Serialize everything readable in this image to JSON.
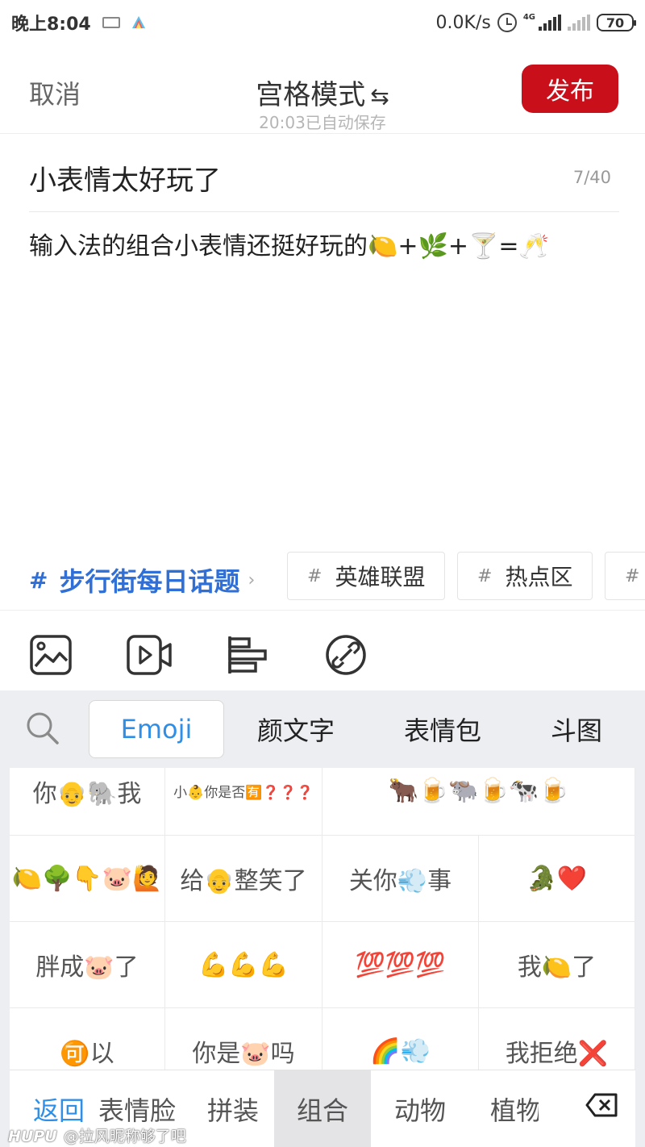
{
  "status_bar": {
    "time": "晚上8:04",
    "net_speed": "0.0K/s",
    "network_type": "4G",
    "battery": "70",
    "icons": [
      "keyboard-icon",
      "app-icon",
      "alarm-icon",
      "signal-icon",
      "signal-icon",
      "battery-icon"
    ]
  },
  "nav": {
    "cancel": "取消",
    "mode": "宫格模式",
    "mode_icon": "⇆",
    "autosave": "20:03已自动保存",
    "publish": "发布",
    "publish_color": "#c9101a"
  },
  "editor": {
    "title": "小表情太好玩了",
    "title_count": "7/40",
    "body": "输入法的组合小表情还挺好玩的🍋+🌿+🍸=🥂"
  },
  "topics": {
    "main": "步行街每日话题",
    "chips": [
      "英雄联盟",
      "热点区",
      ""
    ]
  },
  "toolbar": {
    "icons": [
      "image-icon",
      "video-icon",
      "align-icon",
      "link-icon"
    ]
  },
  "keyboard": {
    "tabs": [
      "Emoji",
      "颜文字",
      "表情包",
      "斗图"
    ],
    "active_tab": "Emoji",
    "accent_color": "#2f8fe6",
    "combos": [
      [
        "你👴🐘我",
        "小👶你是否🈶❓❓❓",
        "🐂🍺🐃🍺🐄🍺"
      ],
      [
        "🍋🌳👇🐷🙋",
        "给👴整笑了",
        "关你💨事",
        "🐊❤️"
      ],
      [
        "胖成🐷了",
        "💪💪💪",
        "💯💯💯",
        "我🍋了"
      ],
      [
        "🉑以",
        "你是🐷吗",
        "🌈💨",
        "我拒绝❌"
      ]
    ],
    "categories": [
      "返回",
      "表情脸",
      "拼装",
      "组合",
      "动物",
      "植物"
    ],
    "active_category": "组合"
  },
  "watermark": {
    "brand": "HUPU",
    "user": "@拉风昵称够了吧"
  }
}
